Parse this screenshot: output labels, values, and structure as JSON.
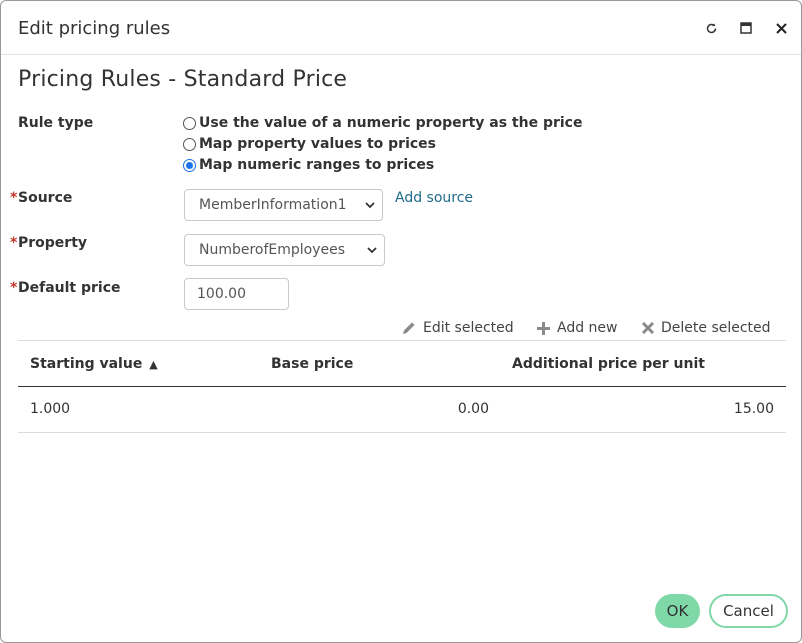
{
  "window": {
    "title": "Edit pricing rules"
  },
  "page": {
    "heading": "Pricing Rules - Standard Price"
  },
  "form": {
    "rule_type_label": "Rule type",
    "rule_type_options": [
      {
        "label": "Use the value of a numeric property as the price",
        "checked": false
      },
      {
        "label": "Map property values to prices",
        "checked": false
      },
      {
        "label": "Map numeric ranges to prices",
        "checked": true
      }
    ],
    "source_label": "Source",
    "source_value": "MemberInformation1",
    "add_source_label": "Add source",
    "property_label": "Property",
    "property_value": "NumberofEmployees",
    "default_price_label": "Default price",
    "default_price_value": "100.00",
    "required_marker": "*"
  },
  "toolbar": {
    "edit_label": "Edit selected",
    "add_label": "Add new",
    "delete_label": "Delete selected"
  },
  "table": {
    "columns": [
      "Starting value",
      "Base price",
      "Additional price per unit"
    ],
    "sort_indicator": "▲",
    "rows": [
      {
        "starting_value": "1.000",
        "base_price": "0.00",
        "additional_price": "15.00"
      }
    ]
  },
  "footer": {
    "ok_label": "OK",
    "cancel_label": "Cancel"
  },
  "colors": {
    "accent": "#7fd8a8",
    "link": "#1f6a8a",
    "required": "#c0392b",
    "radio_checked": "#1a73e8"
  }
}
